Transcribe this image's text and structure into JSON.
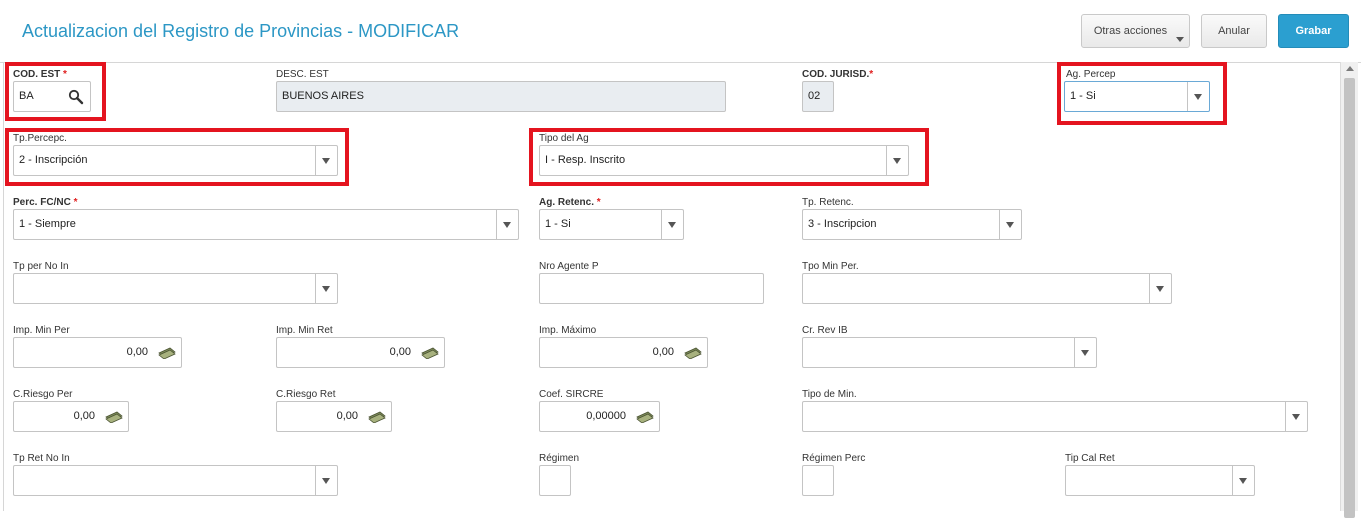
{
  "header": {
    "title": "Actualizacion del Registro de Provincias - MODIFICAR",
    "btn_more": "Otras acciones",
    "btn_cancel": "Anular",
    "btn_save": "Grabar"
  },
  "fields": {
    "cod_est": {
      "label": "COD. EST",
      "required": "*",
      "value": "BA",
      "icon": "search-icon"
    },
    "desc_est": {
      "label": "DESC. EST",
      "value": "BUENOS AIRES"
    },
    "cod_jurisd": {
      "label": "COD. JURISD.",
      "required": "*",
      "value": "02"
    },
    "ag_percep": {
      "label": "Ag. Percep",
      "value": "1 - Si"
    },
    "tp_percepc": {
      "label": "Tp.Percepc.",
      "value": "2 - Inscripción"
    },
    "tipo_ag": {
      "label": "Tipo del Ag",
      "value": "I - Resp. Inscrito"
    },
    "perc_fcnc": {
      "label": "Perc. FC/NC",
      "required": "*",
      "value": "1 - Siempre"
    },
    "ag_retenc": {
      "label": "Ag. Retenc.",
      "required": "*",
      "value": "1 - Si"
    },
    "tp_retenc": {
      "label": "Tp. Retenc.",
      "value": "3 - Inscripcion"
    },
    "tp_per_no_in": {
      "label": "Tp per No In",
      "value": ""
    },
    "nro_agente_p": {
      "label": "Nro Agente P",
      "value": ""
    },
    "tpo_min_per": {
      "label": "Tpo Min Per.",
      "value": ""
    },
    "imp_min_per": {
      "label": "Imp. Min Per",
      "value": "0,00"
    },
    "imp_min_ret": {
      "label": "Imp. Min Ret",
      "value": "0,00"
    },
    "imp_maximo": {
      "label": "Imp. Máximo",
      "value": "0,00"
    },
    "cr_rev_ib": {
      "label": "Cr. Rev IB",
      "value": ""
    },
    "c_riesgo_per": {
      "label": "C.Riesgo Per",
      "value": "0,00"
    },
    "c_riesgo_ret": {
      "label": "C.Riesgo Ret",
      "value": "0,00"
    },
    "coef_sircre": {
      "label": "Coef. SIRCRE",
      "value": "0,00000"
    },
    "tipo_de_min": {
      "label": "Tipo de Min.",
      "value": ""
    },
    "tp_ret_no_in": {
      "label": "Tp Ret No In",
      "value": ""
    },
    "regimen": {
      "label": "Régimen",
      "value": ""
    },
    "regimen_perc": {
      "label": "Régimen Perc",
      "value": ""
    },
    "tip_cal_ret": {
      "label": "Tip Cal Ret",
      "value": ""
    }
  },
  "colors": {
    "accent": "#2c97c5",
    "primary_button": "#2b9fd0",
    "highlight": "#e4141f",
    "required": "#e02020"
  }
}
